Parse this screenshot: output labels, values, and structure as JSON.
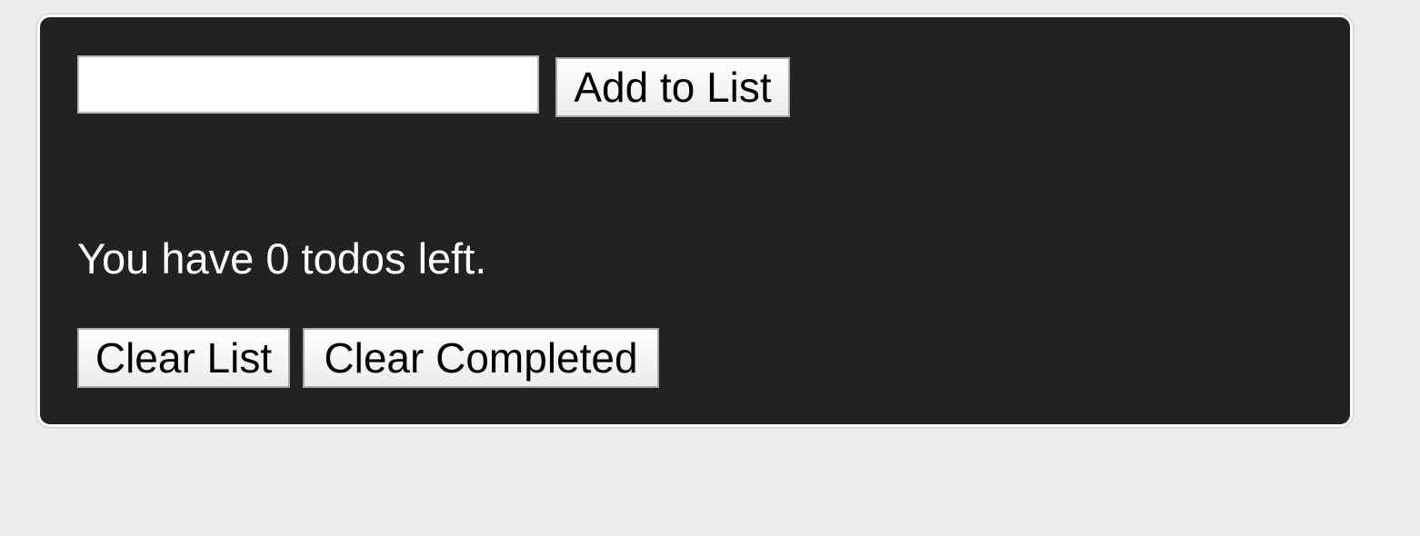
{
  "todo_form": {
    "input": {
      "value": "",
      "placeholder": ""
    },
    "add_button_label": "Add to List"
  },
  "todo_list": {
    "items": []
  },
  "status": {
    "todos_left_text": "You have 0 todos left."
  },
  "actions": {
    "clear_list_label": "Clear List",
    "clear_completed_label": "Clear Completed"
  },
  "colors": {
    "page_background": "#ededed",
    "panel_background": "#222222",
    "panel_border": "#ffffff",
    "text_on_panel": "#ffffff",
    "button_background": "#f0f0f0",
    "button_border": "#a9a9a9"
  }
}
